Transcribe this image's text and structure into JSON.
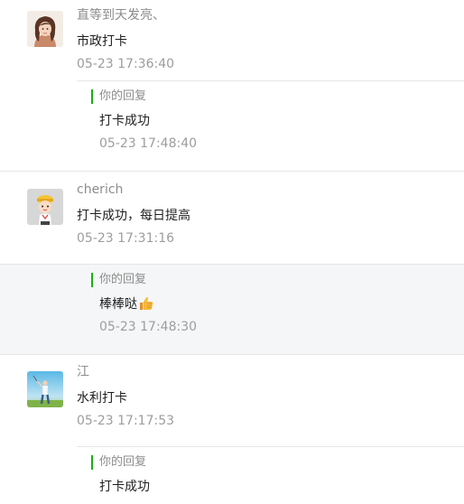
{
  "comments": [
    {
      "nickname": "直等到天发亮、",
      "avatar_icon": "avatar-girl-brown-hair",
      "content": "市政打卡",
      "time": "05-23 17:36:40",
      "reply": {
        "label": "你的回复",
        "content": "打卡成功",
        "time": "05-23 17:48:40"
      }
    },
    {
      "nickname": "cherich",
      "avatar_icon": "avatar-cartoon-kid-hat",
      "content": "打卡成功，每日提高",
      "time": "05-23 17:31:16",
      "reply": {
        "label": "你的回复",
        "content": "棒棒哒",
        "emoji": "thumbs-up-emoji",
        "time": "05-23 17:48:30"
      }
    },
    {
      "nickname": "江",
      "avatar_icon": "avatar-golfer-sky",
      "content": "水利打卡",
      "time": "05-23 17:17:53",
      "reply": {
        "label": "你的回复",
        "content": "打卡成功"
      }
    }
  ],
  "colors": {
    "accent_bar": "#1aad19",
    "highlight_bg": "#f5f6f8",
    "muted_text": "#9d9d9d",
    "divider": "#e6e6e6"
  }
}
